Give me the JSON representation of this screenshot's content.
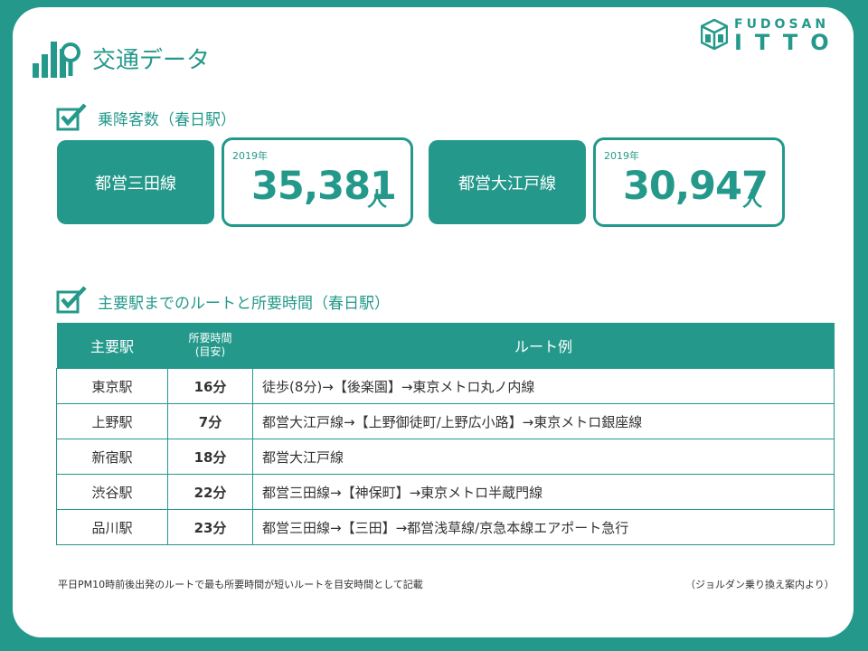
{
  "header": {
    "title": "交通データ",
    "logo_top": "FUDOSAN",
    "logo_bottom": "ITTO"
  },
  "section1": {
    "title": "乗降客数（春日駅）",
    "stats": [
      {
        "line": "都営三田線",
        "year": "2019年",
        "count": "35,381",
        "unit": "人"
      },
      {
        "line": "都営大江戸線",
        "year": "2019年",
        "count": "30,947",
        "unit": "人"
      }
    ]
  },
  "section2": {
    "title": "主要駅までのルートと所要時間（春日駅）"
  },
  "table": {
    "headers": {
      "station": "主要駅",
      "time_line1": "所要時間",
      "time_line2": "(目安)",
      "route": "ルート例"
    },
    "rows": [
      {
        "station": "東京駅",
        "time": "16分",
        "route": "徒歩(8分)→【後楽園】→東京メトロ丸ノ内線"
      },
      {
        "station": "上野駅",
        "time": "7分",
        "route": "都営大江戸線→【上野御徒町/上野広小路】→東京メトロ銀座線"
      },
      {
        "station": "新宿駅",
        "time": "18分",
        "route": "都営大江戸線"
      },
      {
        "station": "渋谷駅",
        "time": "22分",
        "route": "都営三田線→【神保町】→東京メトロ半蔵門線"
      },
      {
        "station": "品川駅",
        "time": "23分",
        "route": "都営三田線→【三田】→都営浅草線/京急本線エアポート急行"
      }
    ]
  },
  "footer": {
    "note": "平日PM10時前後出発のルートで最も所要時間が短いルートを目安時間として記載",
    "source": "（ジョルダン乗り換え案内より）"
  },
  "colors": {
    "accent": "#24998b",
    "background": "#24998b",
    "card": "#ffffff"
  },
  "icons": [
    "chart-search-icon",
    "logo-mark-icon",
    "checkbox-icon"
  ]
}
